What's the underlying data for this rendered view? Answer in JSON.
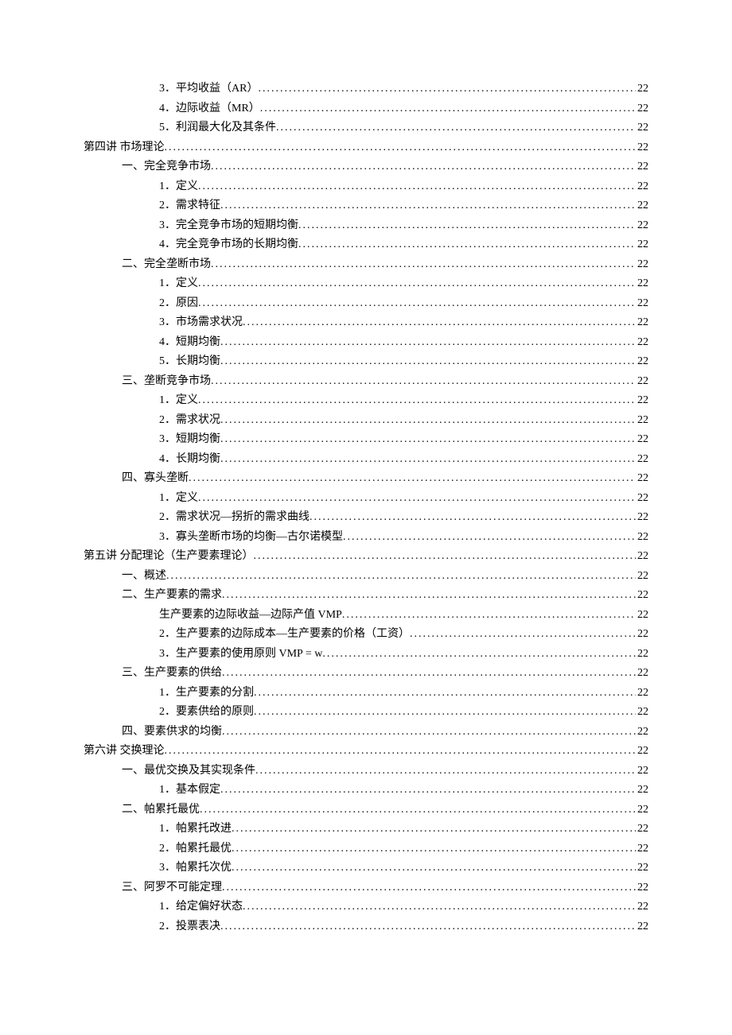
{
  "toc": [
    {
      "level": 2,
      "label": "3．平均收益（AR）",
      "page": "22"
    },
    {
      "level": 2,
      "label": "4．边际收益（MR）",
      "page": "22"
    },
    {
      "level": 2,
      "label": "5．利润最大化及其条件",
      "page": "22"
    },
    {
      "level": 0,
      "label": "第四讲 市场理论",
      "page": "22"
    },
    {
      "level": 1,
      "label": "一、完全竞争市场",
      "page": "22"
    },
    {
      "level": 2,
      "label": "1．定义",
      "page": "22"
    },
    {
      "level": 2,
      "label": "2．需求特征",
      "page": "22"
    },
    {
      "level": 2,
      "label": "3．完全竞争市场的短期均衡",
      "page": "22"
    },
    {
      "level": 2,
      "label": "4．完全竞争市场的长期均衡",
      "page": "22"
    },
    {
      "level": 1,
      "label": "二、完全垄断市场",
      "page": "22"
    },
    {
      "level": 2,
      "label": "1．定义",
      "page": "22"
    },
    {
      "level": 2,
      "label": "2．原因",
      "page": "22"
    },
    {
      "level": 2,
      "label": "3．市场需求状况",
      "page": "22"
    },
    {
      "level": 2,
      "label": "4．短期均衡",
      "page": "22"
    },
    {
      "level": 2,
      "label": "5．长期均衡",
      "page": "22"
    },
    {
      "level": 1,
      "label": "三、垄断竞争市场",
      "page": "22"
    },
    {
      "level": 2,
      "label": "1．定义",
      "page": "22"
    },
    {
      "level": 2,
      "label": "2．需求状况",
      "page": "22"
    },
    {
      "level": 2,
      "label": "3．短期均衡",
      "page": "22"
    },
    {
      "level": 2,
      "label": "4．长期均衡",
      "page": "22"
    },
    {
      "level": 1,
      "label": "四、寡头垄断",
      "page": "22"
    },
    {
      "level": 2,
      "label": "1．定义",
      "page": "22"
    },
    {
      "level": 2,
      "label": "2．需求状况—拐折的需求曲线",
      "page": "22"
    },
    {
      "level": 2,
      "label": "3．寡头垄断市场的均衡—古尔诺模型",
      "page": "22"
    },
    {
      "level": 0,
      "label": "第五讲 分配理论（生产要素理论）",
      "page": "22"
    },
    {
      "level": 1,
      "label": "一、概述",
      "page": "22"
    },
    {
      "level": 1,
      "label": "二、生产要素的需求",
      "page": "22"
    },
    {
      "level": 2,
      "label": "生产要素的边际收益—边际产值 VMP",
      "page": "22"
    },
    {
      "level": 2,
      "label": "2．生产要素的边际成本—生产要素的价格（工资）",
      "page": "22"
    },
    {
      "level": 2,
      "label": "3．生产要素的使用原则  VMP = w",
      "page": "22"
    },
    {
      "level": 1,
      "label": "三、生产要素的供给",
      "page": "22"
    },
    {
      "level": 2,
      "label": "1．生产要素的分割",
      "page": "22"
    },
    {
      "level": 2,
      "label": "2．要素供给的原则",
      "page": "22"
    },
    {
      "level": 1,
      "label": "四、要素供求的均衡",
      "page": "22"
    },
    {
      "level": 0,
      "label": "第六讲 交换理论",
      "page": "22"
    },
    {
      "level": 1,
      "label": "一、最优交换及其实现条件",
      "page": "22"
    },
    {
      "level": 2,
      "label": "1．基本假定",
      "page": "22"
    },
    {
      "level": 1,
      "label": "二、帕累托最优",
      "page": "22"
    },
    {
      "level": 2,
      "label": "1．帕累托改进",
      "page": "22"
    },
    {
      "level": 2,
      "label": "2．帕累托最优",
      "page": "22"
    },
    {
      "level": 2,
      "label": "3．帕累托次优",
      "page": "22"
    },
    {
      "level": 1,
      "label": "三、阿罗不可能定理",
      "page": "22"
    },
    {
      "level": 2,
      "label": "1．给定偏好状态",
      "page": "22"
    },
    {
      "level": 2,
      "label": "2．投票表决",
      "page": "22"
    }
  ]
}
